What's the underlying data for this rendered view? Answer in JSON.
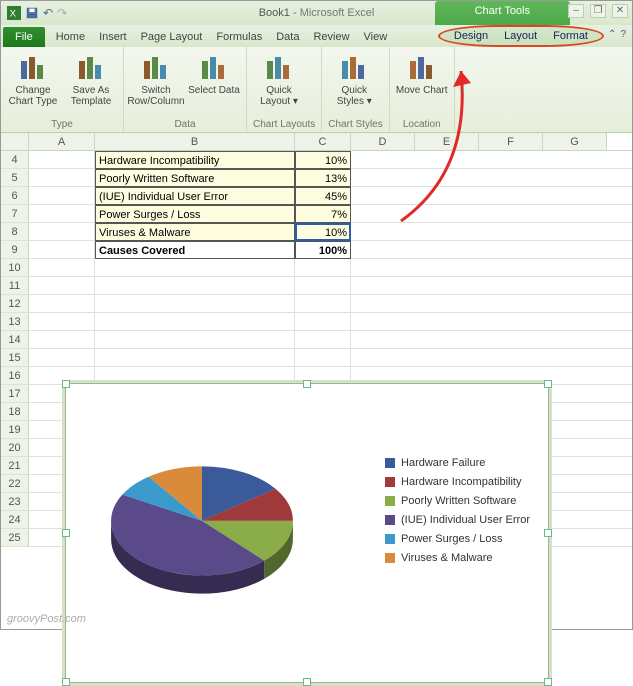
{
  "title": {
    "doc": "Book1",
    "sep": " - ",
    "app": "Microsoft Excel"
  },
  "chart_tools_label": "Chart Tools",
  "tabs": {
    "file": "File",
    "list": [
      "Home",
      "Insert",
      "Page Layout",
      "Formulas",
      "Data",
      "Review",
      "View"
    ],
    "contextual": [
      "Design",
      "Layout",
      "Format"
    ]
  },
  "ribbon": {
    "groups": [
      {
        "label": "Type",
        "buttons": [
          "Change Chart Type",
          "Save As Template"
        ]
      },
      {
        "label": "Data",
        "buttons": [
          "Switch Row/Column",
          "Select Data"
        ]
      },
      {
        "label": "Chart Layouts",
        "buttons": [
          "Quick Layout ▾"
        ]
      },
      {
        "label": "Chart Styles",
        "buttons": [
          "Quick Styles ▾"
        ]
      },
      {
        "label": "Location",
        "buttons": [
          "Move Chart"
        ]
      }
    ]
  },
  "columns": [
    "A",
    "B",
    "C",
    "D",
    "E",
    "F",
    "G"
  ],
  "row_start": 4,
  "row_count": 22,
  "table": [
    {
      "b": "Hardware Incompatibility",
      "c": "10%"
    },
    {
      "b": "Poorly Written Software",
      "c": "13%"
    },
    {
      "b": "(IUE) Individual User Error",
      "c": "45%"
    },
    {
      "b": "Power Surges / Loss",
      "c": "7%"
    },
    {
      "b": "Viruses & Malware",
      "c": "10%"
    },
    {
      "b": "Causes Covered",
      "c": "100%",
      "bold": true
    }
  ],
  "chart_data": {
    "type": "pie",
    "title": "",
    "series": [
      {
        "name": "Hardware Failure",
        "value": 15,
        "color": "#3b5a9a"
      },
      {
        "name": "Hardware Incompatibility",
        "value": 10,
        "color": "#a03a3a"
      },
      {
        "name": "Poorly Written Software",
        "value": 13,
        "color": "#8aad4a"
      },
      {
        "name": "(IUE) Individual User Error",
        "value": 45,
        "color": "#5a4a8a"
      },
      {
        "name": "Power Surges / Loss",
        "value": 7,
        "color": "#3a9acb"
      },
      {
        "name": "Viruses & Malware",
        "value": 10,
        "color": "#d98a3a"
      }
    ]
  },
  "watermark": "groovyPost.com"
}
